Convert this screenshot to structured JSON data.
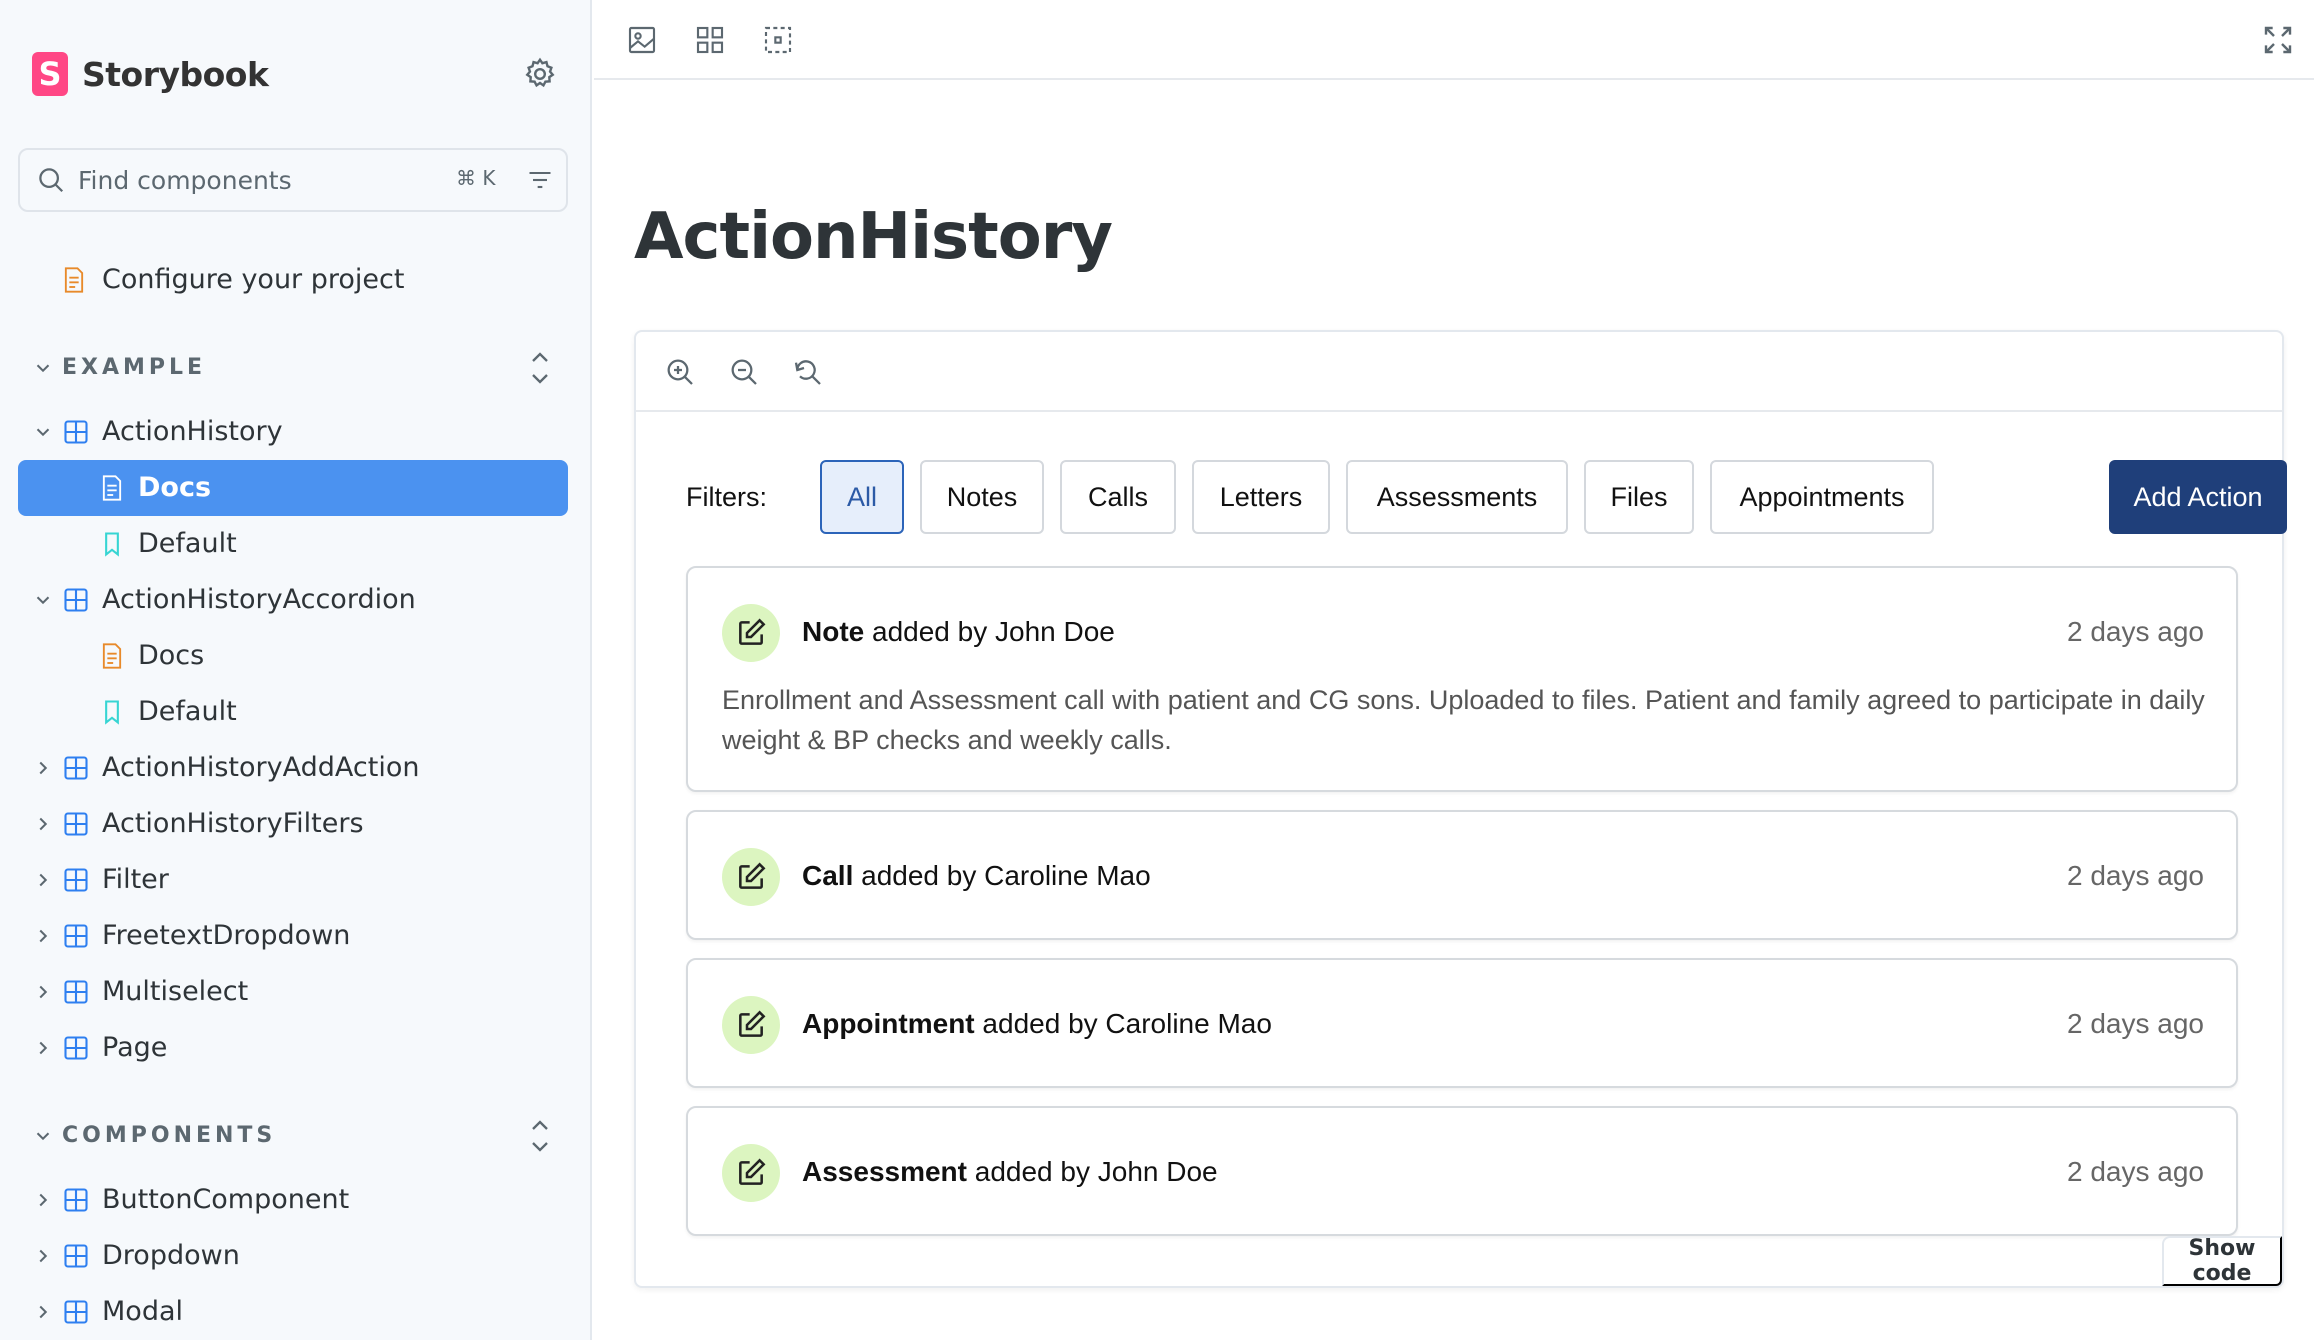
{
  "app": {
    "brand": "Storybook",
    "brand_logo_letter": "S"
  },
  "search": {
    "placeholder": "Find components",
    "shortcut": "⌘ K"
  },
  "sidebar": {
    "configure": "Configure your project",
    "sections": [
      {
        "label": "EXAMPLE"
      },
      {
        "label": "COMPONENTS"
      }
    ],
    "example_items": [
      {
        "label": "ActionHistory",
        "type": "component",
        "expanded": true
      },
      {
        "label": "Docs",
        "type": "docs",
        "active": true
      },
      {
        "label": "Default",
        "type": "story"
      },
      {
        "label": "ActionHistoryAccordion",
        "type": "component",
        "expanded": true
      },
      {
        "label": "Docs",
        "type": "docs"
      },
      {
        "label": "Default",
        "type": "story"
      },
      {
        "label": "ActionHistoryAddAction",
        "type": "component"
      },
      {
        "label": "ActionHistoryFilters",
        "type": "component"
      },
      {
        "label": "Filter",
        "type": "component"
      },
      {
        "label": "FreetextDropdown",
        "type": "component"
      },
      {
        "label": "Multiselect",
        "type": "component"
      },
      {
        "label": "Page",
        "type": "component"
      }
    ],
    "component_items": [
      {
        "label": "ButtonComponent"
      },
      {
        "label": "Dropdown"
      },
      {
        "label": "Modal"
      }
    ]
  },
  "doc": {
    "title": "ActionHistory",
    "show_code": "Show code"
  },
  "story": {
    "filters_label": "Filters:",
    "filters": [
      "All",
      "Notes",
      "Calls",
      "Letters",
      "Assessments",
      "Files",
      "Appointments"
    ],
    "selected_filter": "All",
    "add_action": "Add Action",
    "actions": [
      {
        "type": "Note",
        "by": "added by John Doe",
        "time": "2 days ago",
        "body": "Enrollment and Assessment call with patient and CG sons. Uploaded to files. Patient and family agreed to participate in daily weight & BP checks and weekly calls."
      },
      {
        "type": "Call",
        "by": "added by Caroline Mao",
        "time": "2 days ago"
      },
      {
        "type": "Appointment",
        "by": "added by Caroline Mao",
        "time": "2 days ago"
      },
      {
        "type": "Assessment",
        "by": "added by John Doe",
        "time": "2 days ago"
      }
    ]
  },
  "colors": {
    "accent": "#4b92f0",
    "brand": "#ff4785",
    "primary_button": "#1f3f7a",
    "action_icon_bg": "#dcf5c0"
  }
}
